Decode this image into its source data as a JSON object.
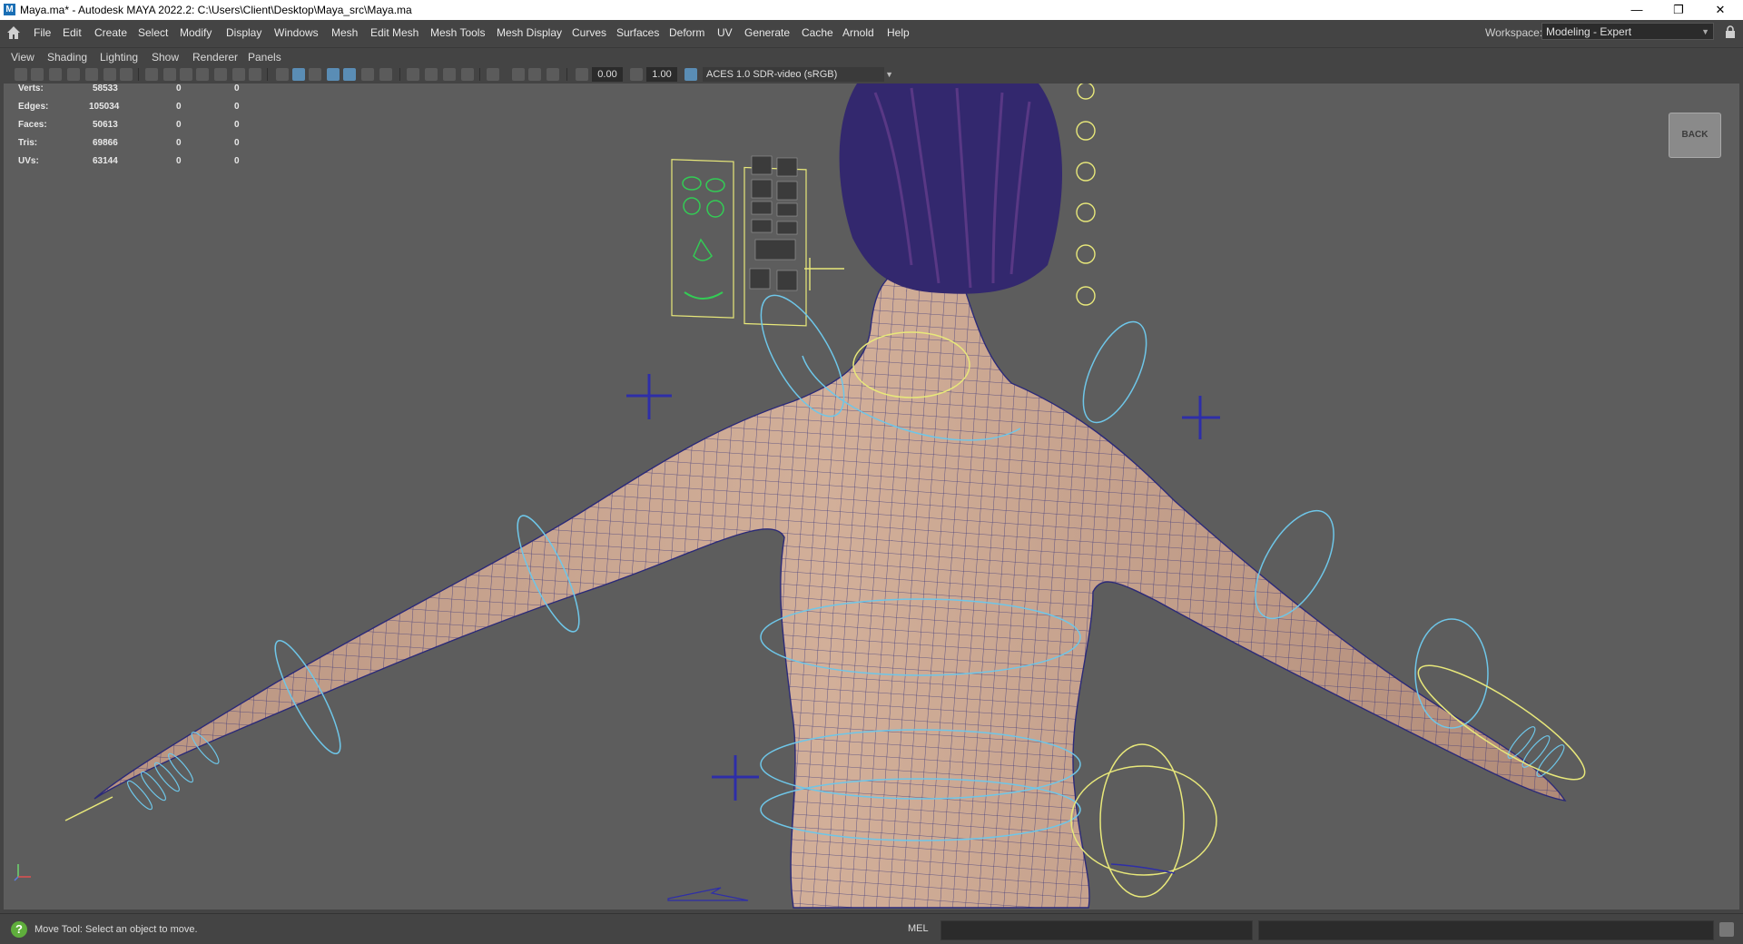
{
  "window": {
    "title": "Maya.ma* - Autodesk MAYA 2022.2: C:\\Users\\Client\\Desktop\\Maya_src\\Maya.ma",
    "app_icon_letter": "M",
    "minimize_glyph": "—",
    "restore_glyph": "❐",
    "close_glyph": "✕"
  },
  "menubar": {
    "items": [
      "File",
      "Edit",
      "Create",
      "Select",
      "Modify",
      "Display",
      "Windows",
      "Mesh",
      "Edit Mesh",
      "Mesh Tools",
      "Mesh Display",
      "Curves",
      "Surfaces",
      "Deform",
      "UV",
      "Generate",
      "Cache",
      "Arnold",
      "Help"
    ],
    "workspace_label": "Workspace:",
    "workspace_value": "Modeling - Expert"
  },
  "panel_menu": {
    "items": [
      "View",
      "Shading",
      "Lighting",
      "Show",
      "Renderer",
      "Panels"
    ]
  },
  "panel_toolbar": {
    "exposure_value": "0.00",
    "gamma_value": "1.00",
    "color_space": "ACES 1.0 SDR-video (sRGB)"
  },
  "hud": {
    "rows": [
      {
        "label": "Verts:",
        "total": "58533",
        "sel": "0",
        "comp": "0"
      },
      {
        "label": "Edges:",
        "total": "105034",
        "sel": "0",
        "comp": "0"
      },
      {
        "label": "Faces:",
        "total": "50613",
        "sel": "0",
        "comp": "0"
      },
      {
        "label": "Tris:",
        "total": "69866",
        "sel": "0",
        "comp": "0"
      },
      {
        "label": "UVs:",
        "total": "63144",
        "sel": "0",
        "comp": "0"
      }
    ]
  },
  "viewcube": {
    "label": "BACK"
  },
  "statusbar": {
    "help_text": "Move Tool: Select an object to move.",
    "mel_label": "MEL"
  },
  "colors": {
    "viewport_bg": "#5d5d5d",
    "skin": "#c9a690",
    "wire": "#2b2a78",
    "control_yellow": "#e8e87a",
    "control_cyan": "#6ec6e8",
    "control_blue": "#2e2ea8",
    "hair": "#3a2a7a"
  }
}
